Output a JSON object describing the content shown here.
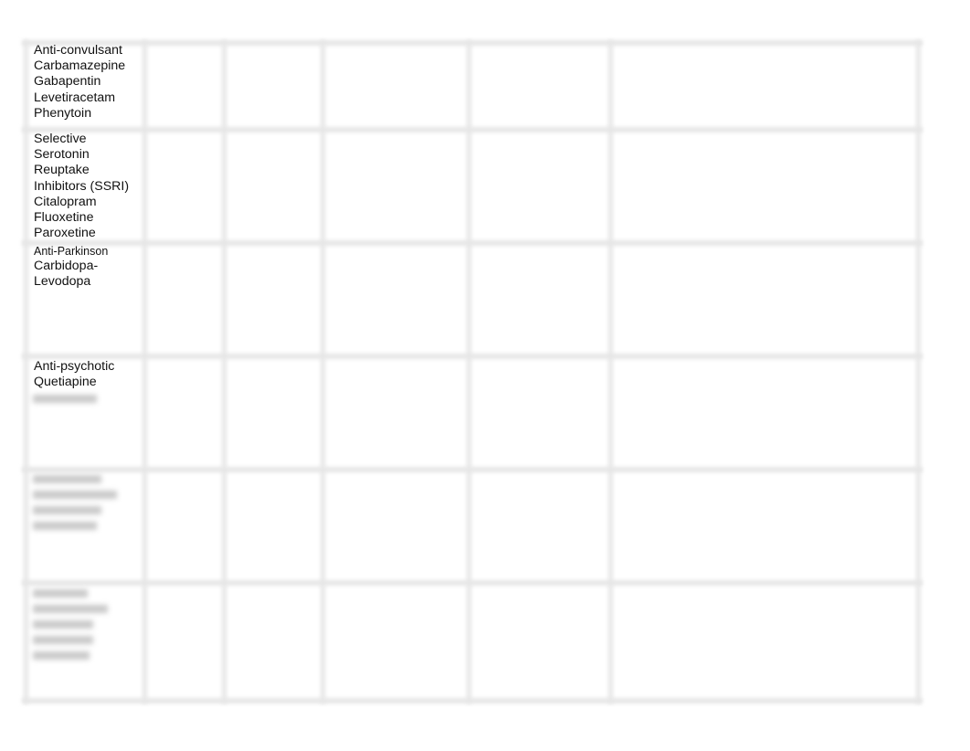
{
  "table": {
    "rows": [
      {
        "header": "Anti-convulsant",
        "drugs": [
          "Carbamazepine",
          "Gabapentin",
          "Levetiracetam",
          "Phenytoin"
        ]
      },
      {
        "header": "Selective Serotonin Reuptake Inhibitors (SSRI)",
        "header_lines": [
          "Selective",
          "Serotonin",
          "Reuptake",
          "Inhibitors (SSRI)"
        ],
        "drugs": [
          "Citalopram",
          "Fluoxetine",
          "Paroxetine"
        ]
      },
      {
        "header": "Anti-Parkinson",
        "drugs": [
          "Carbidopa-",
          "Levodopa"
        ]
      },
      {
        "header": "Anti-psychotic",
        "drugs": [
          "Quetiapine"
        ]
      }
    ],
    "column_count": 7,
    "row_count": 6
  }
}
